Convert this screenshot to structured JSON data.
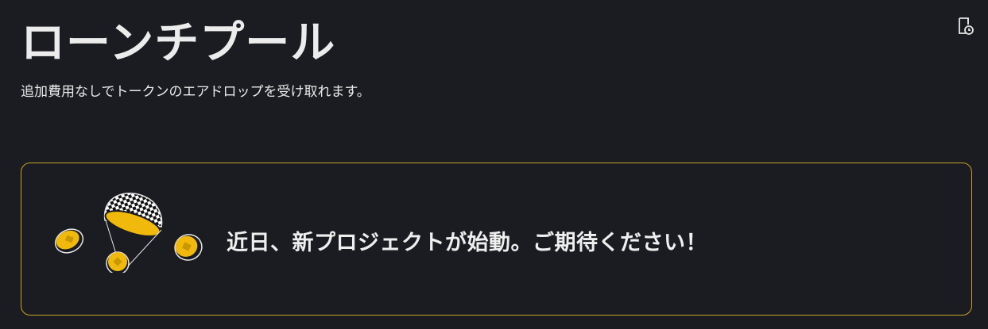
{
  "header": {
    "title": "ローンチプール",
    "subtitle": "追加費用なしでトークンのエアドロップを受け取れます。",
    "history_icon": "history-document-icon"
  },
  "banner": {
    "message": "近日、新プロジェクトが始動。ご期待ください！",
    "illustration_icon": "parachute-coins-icon"
  },
  "colors": {
    "background": "#1b1c21",
    "accent": "#f0b90b",
    "border": "#c9a227",
    "text": "#ececec"
  }
}
